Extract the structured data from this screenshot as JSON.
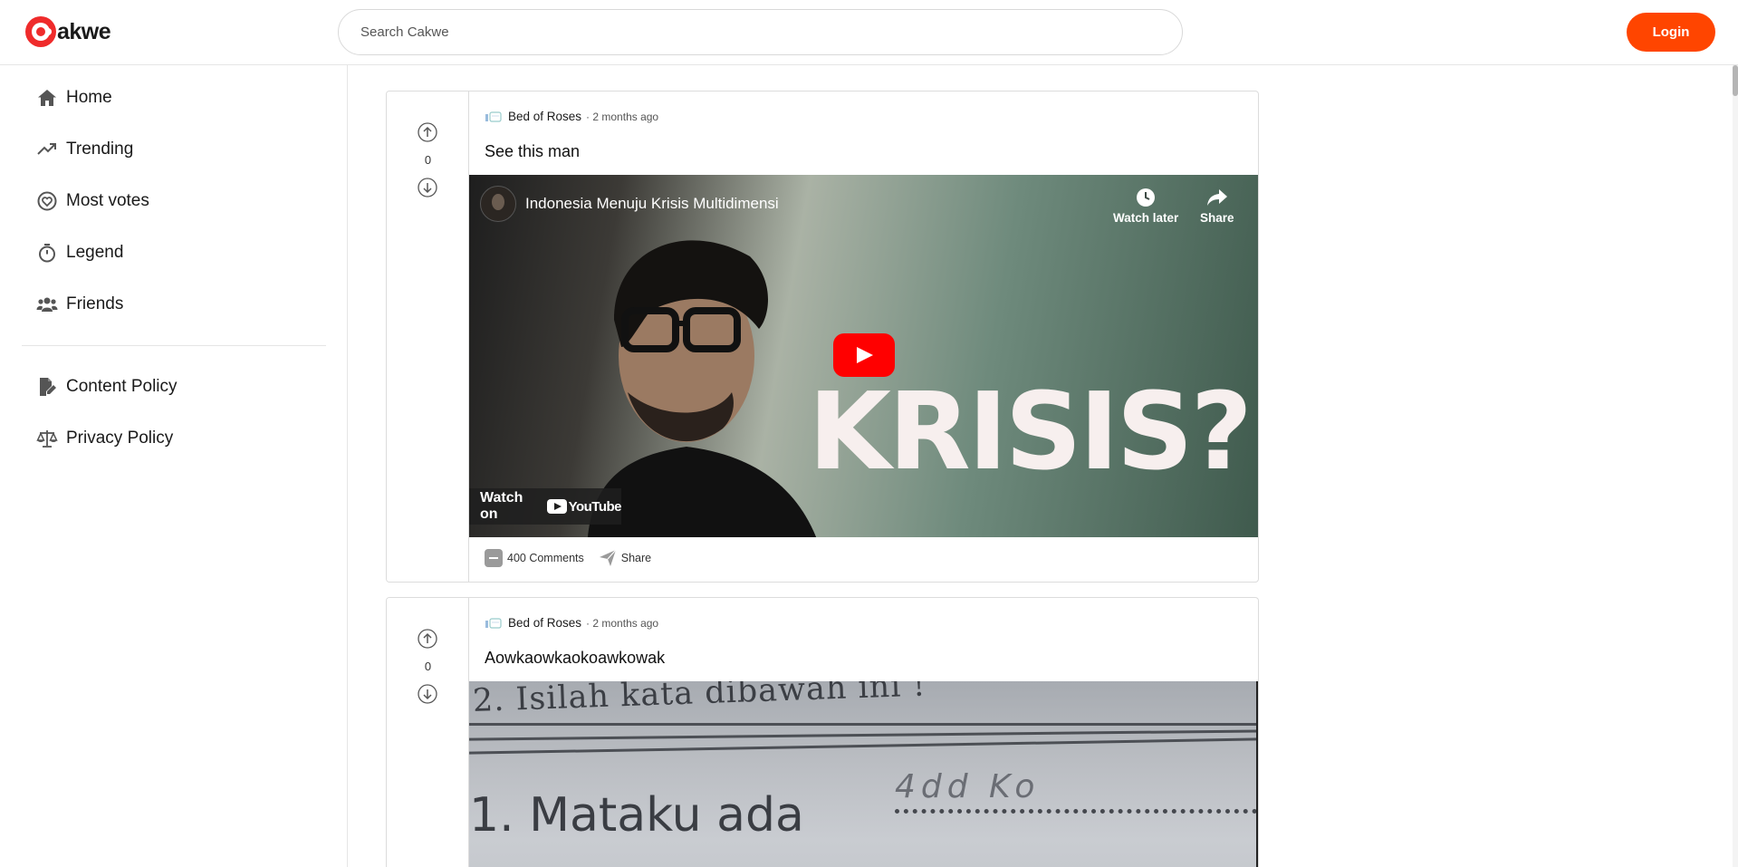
{
  "brand": {
    "name": "akwe",
    "accent": "#ff4500",
    "logo_color": "#ef2b2b"
  },
  "search": {
    "placeholder": "Search Cakwe",
    "value": ""
  },
  "header": {
    "login_label": "Login"
  },
  "sidebar": {
    "items": [
      {
        "label": "Home",
        "icon": "home-icon"
      },
      {
        "label": "Trending",
        "icon": "trending-icon"
      },
      {
        "label": "Most votes",
        "icon": "heart-circle-icon"
      },
      {
        "label": "Legend",
        "icon": "stopwatch-icon"
      },
      {
        "label": "Friends",
        "icon": "friends-icon"
      }
    ],
    "policies": [
      {
        "label": "Content Policy",
        "icon": "file-signature-icon"
      },
      {
        "label": "Privacy Policy",
        "icon": "scale-icon"
      }
    ]
  },
  "posts": [
    {
      "votes": "0",
      "community": "Bed of Roses",
      "time": "· 2 months ago",
      "title": "See this man",
      "video": {
        "title": "Indonesia Menuju Krisis Multidimensi",
        "watch_later": "Watch later",
        "share": "Share",
        "overlay_text": "KRISIS?",
        "watch_on": "Watch on",
        "platform": "YouTube"
      },
      "comments": "400 Comments",
      "share_label": "Share"
    },
    {
      "votes": "0",
      "community": "Bed of Roses",
      "time": "· 2 months ago",
      "title": "Aowkaowkaokoawkowak",
      "image_text": {
        "line1": "2.  Isilah kata dibawah ini !",
        "line2": "1. Mataku ada",
        "handwriting": "4dd Ko"
      }
    }
  ]
}
